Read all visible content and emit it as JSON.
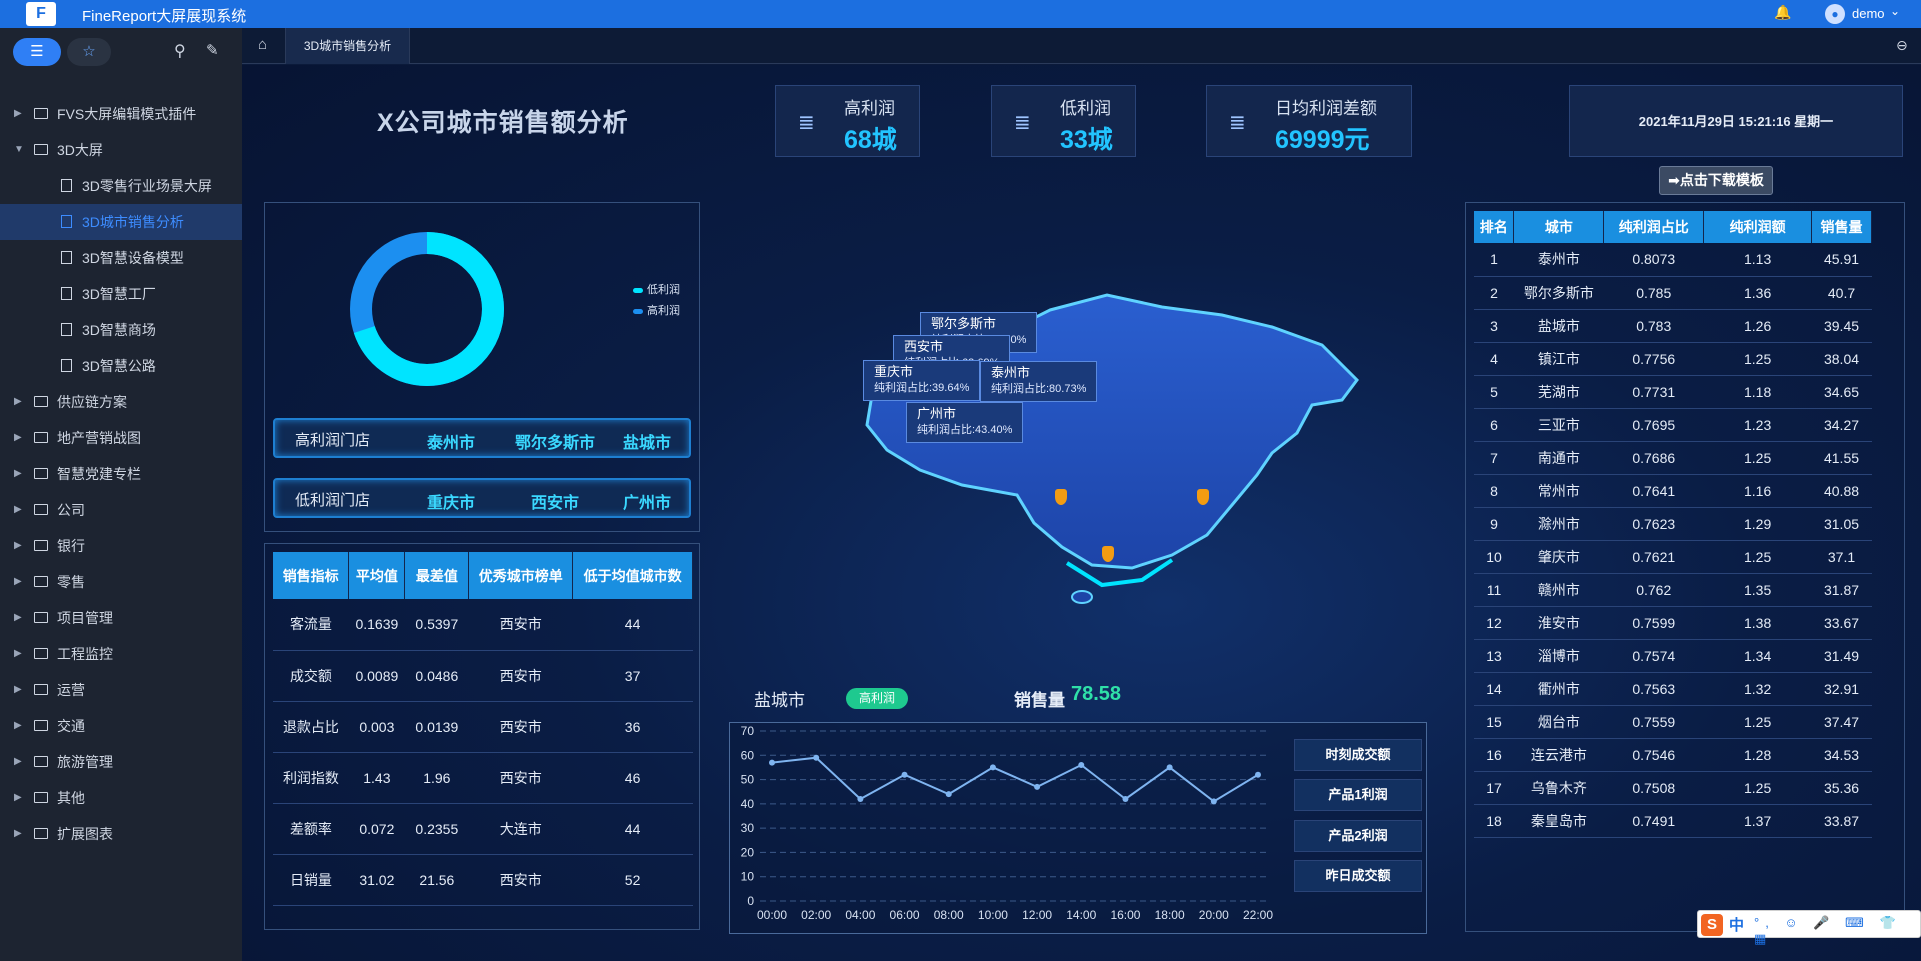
{
  "app": {
    "title": "FineReport大屏展现系统",
    "logo_text": "F",
    "username": "demo"
  },
  "sidebar": {
    "items": [
      {
        "label": "FVS大屏编辑模式插件",
        "expanded": false
      },
      {
        "label": "3D大屏",
        "expanded": true
      },
      {
        "label": "供应链方案",
        "expanded": false
      },
      {
        "label": "地产营销战图",
        "expanded": false
      },
      {
        "label": "智慧党建专栏",
        "expanded": false
      },
      {
        "label": "公司",
        "expanded": false
      },
      {
        "label": "银行",
        "expanded": false
      },
      {
        "label": "零售",
        "expanded": false
      },
      {
        "label": "项目管理",
        "expanded": false
      },
      {
        "label": "工程监控",
        "expanded": false
      },
      {
        "label": "运营",
        "expanded": false
      },
      {
        "label": "交通",
        "expanded": false
      },
      {
        "label": "旅游管理",
        "expanded": false
      },
      {
        "label": "其他",
        "expanded": false
      },
      {
        "label": "扩展图表",
        "expanded": false
      }
    ],
    "children": [
      {
        "label": "3D零售行业场景大屏",
        "active": false
      },
      {
        "label": "3D城市销售分析",
        "active": true
      },
      {
        "label": "3D智慧设备模型",
        "active": false
      },
      {
        "label": "3D智慧工厂",
        "active": false
      },
      {
        "label": "3D智慧商场",
        "active": false
      },
      {
        "label": "3D智慧公路",
        "active": false
      }
    ]
  },
  "tabs": {
    "active": "3D城市销售分析"
  },
  "dashboard": {
    "title": "X公司城市销售额分析",
    "kpis": [
      {
        "label": "高利润",
        "value": "68城"
      },
      {
        "label": "低利润",
        "value": "33城"
      },
      {
        "label": "日均利润差额",
        "value": "69999元"
      }
    ],
    "datetime": "2021年11月29日 15:21:16 星期一",
    "download_label": "➡点击下载模板",
    "donut": {
      "legend": [
        "低利润",
        "高利润"
      ],
      "colors": {
        "low": "#00e4ff",
        "high": "#1c8ff0"
      }
    },
    "high_store": {
      "label": "高利润门店",
      "cities": [
        "泰州市",
        "鄂尔多斯市",
        "盐城市"
      ]
    },
    "low_store": {
      "label": "低利润门店",
      "cities": [
        "重庆市",
        "西安市",
        "广州市"
      ]
    },
    "metrics": {
      "headers": [
        "销售指标",
        "平均值",
        "最差值",
        "优秀城市榜单",
        "低于均值城市数"
      ],
      "rows": [
        [
          "客流量",
          "0.1639",
          "0.5397",
          "西安市",
          "44"
        ],
        [
          "成交额",
          "0.0089",
          "0.0486",
          "西安市",
          "37"
        ],
        [
          "退款占比",
          "0.003",
          "0.0139",
          "西安市",
          "36"
        ],
        [
          "利润指数",
          "1.43",
          "1.96",
          "西安市",
          "46"
        ],
        [
          "差额率",
          "0.072",
          "0.2355",
          "大连市",
          "44"
        ],
        [
          "日销量",
          "31.02",
          "21.56",
          "西安市",
          "52"
        ]
      ]
    },
    "map_labels": [
      {
        "city": "鄂尔多斯市",
        "sub": "纯利润占比:78.50%"
      },
      {
        "city": "西安市",
        "sub": "纯利润占比:63.69%"
      },
      {
        "city": "重庆市",
        "sub": "纯利润占比:39.64%"
      },
      {
        "city": "泰州市",
        "sub": "纯利润占比:80.73%"
      },
      {
        "city": "广州市",
        "sub": "纯利润占比:43.40%"
      }
    ],
    "line_section": {
      "city": "盐城市",
      "tag": "高利润",
      "sales_label": "销售量",
      "sales_value": "78.58",
      "buttons": [
        "时刻成交额",
        "产品1利润",
        "产品2利润",
        "昨日成交额"
      ]
    },
    "ranking": {
      "headers": [
        "排名",
        "城市",
        "纯利润占比",
        "纯利润额",
        "销售量"
      ],
      "rows": [
        [
          "1",
          "泰州市",
          "0.8073",
          "1.13",
          "45.91"
        ],
        [
          "2",
          "鄂尔多斯市",
          "0.785",
          "1.36",
          "40.7"
        ],
        [
          "3",
          "盐城市",
          "0.783",
          "1.26",
          "39.45"
        ],
        [
          "4",
          "镇江市",
          "0.7756",
          "1.25",
          "38.04"
        ],
        [
          "5",
          "芜湖市",
          "0.7731",
          "1.18",
          "34.65"
        ],
        [
          "6",
          "三亚市",
          "0.7695",
          "1.23",
          "34.27"
        ],
        [
          "7",
          "南通市",
          "0.7686",
          "1.25",
          "41.55"
        ],
        [
          "8",
          "常州市",
          "0.7641",
          "1.16",
          "40.88"
        ],
        [
          "9",
          "滁州市",
          "0.7623",
          "1.29",
          "31.05"
        ],
        [
          "10",
          "肇庆市",
          "0.7621",
          "1.25",
          "37.1"
        ],
        [
          "11",
          "赣州市",
          "0.762",
          "1.35",
          "31.87"
        ],
        [
          "12",
          "淮安市",
          "0.7599",
          "1.38",
          "33.67"
        ],
        [
          "13",
          "淄博市",
          "0.7574",
          "1.34",
          "31.49"
        ],
        [
          "14",
          "衢州市",
          "0.7563",
          "1.32",
          "32.91"
        ],
        [
          "15",
          "烟台市",
          "0.7559",
          "1.25",
          "37.47"
        ],
        [
          "16",
          "连云港市",
          "0.7546",
          "1.28",
          "34.53"
        ],
        [
          "17",
          "乌鲁木齐",
          "0.7508",
          "1.25",
          "35.36"
        ],
        [
          "18",
          "秦皇岛市",
          "0.7491",
          "1.37",
          "33.87"
        ]
      ]
    }
  },
  "chart_data": {
    "type": "line",
    "x": [
      "00:00",
      "02:00",
      "04:00",
      "06:00",
      "08:00",
      "10:00",
      "12:00",
      "14:00",
      "16:00",
      "18:00",
      "20:00",
      "22:00"
    ],
    "series": [
      {
        "values": [
          57,
          59,
          42,
          52,
          44,
          55,
          47,
          56,
          42,
          55,
          41,
          52
        ]
      }
    ],
    "ylim": [
      0,
      70
    ],
    "yticks": [
      0,
      10,
      20,
      30,
      40,
      50,
      60,
      70
    ],
    "grid": true,
    "color": "#7fb4f0"
  },
  "ime": {
    "logo": "S",
    "mode": "中",
    "icons": "°, ☺ 🎤 ⌨ 👕 ▦"
  }
}
